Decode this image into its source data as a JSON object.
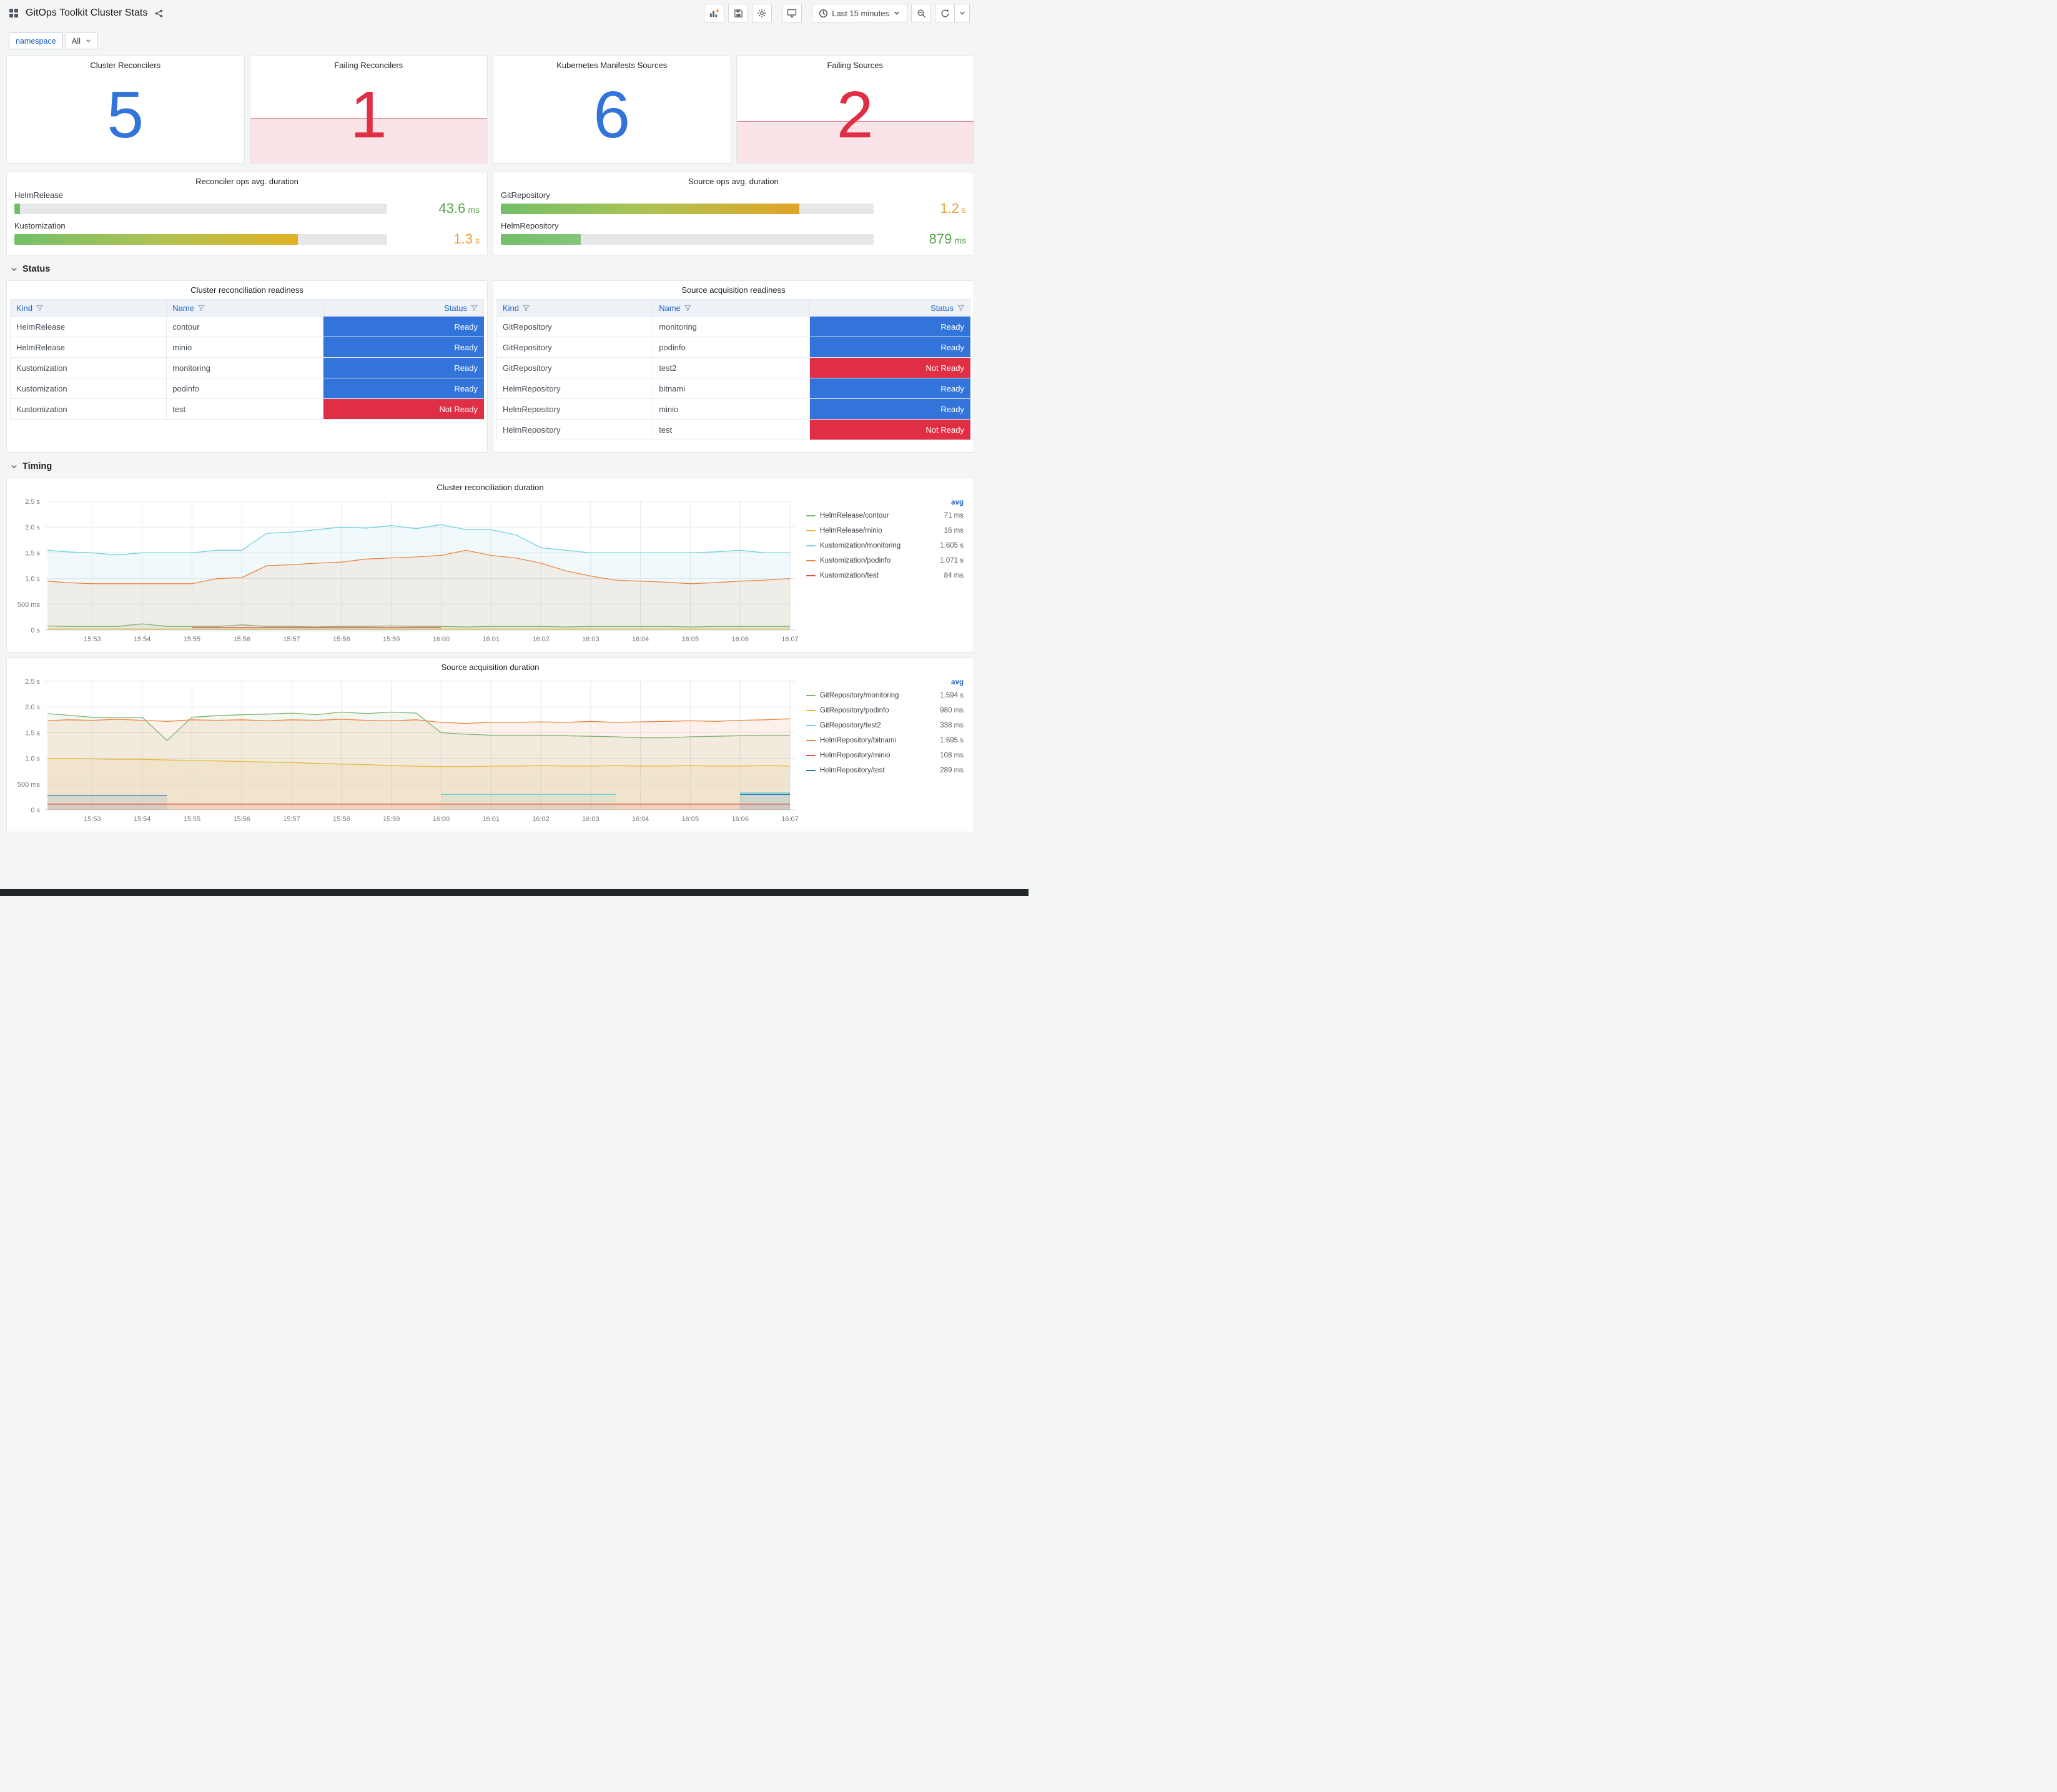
{
  "header": {
    "title": "GitOps Toolkit Cluster Stats",
    "time_range_label": "Last 15 minutes"
  },
  "variables": {
    "label": "namespace",
    "value": "All"
  },
  "sections": {
    "status": "Status",
    "timing": "Timing"
  },
  "colors": {
    "blue": "#3274D9",
    "red": "#E02F44",
    "green_text": "#56A64B",
    "orange_text": "#EDA032"
  },
  "stats": [
    {
      "title": "Cluster Reconcilers",
      "value": "5",
      "color": "#3274D9",
      "spark_pct": 0
    },
    {
      "title": "Failing Reconcilers",
      "value": "1",
      "color": "#E02F44",
      "spark_pct": 42
    },
    {
      "title": "Kubernetes Manifests Sources",
      "value": "6",
      "color": "#3274D9",
      "spark_pct": 0
    },
    {
      "title": "Failing Sources",
      "value": "2",
      "color": "#E02F44",
      "spark_pct": 39
    }
  ],
  "gauges": [
    {
      "title": "Reconciler ops avg. duration",
      "rows": [
        {
          "label": "HelmRelease",
          "value": "43.6",
          "unit": "ms",
          "pct": 1.5,
          "gradient": [
            "#73BF69",
            "#73BF69"
          ],
          "value_color": "#56A64B"
        },
        {
          "label": "Kustomization",
          "value": "1.3",
          "unit": "s",
          "pct": 76,
          "gradient": [
            "#73BF69",
            "#AEC253",
            "#E0B224"
          ],
          "value_color": "#EDA032"
        }
      ]
    },
    {
      "title": "Source ops avg. duration",
      "rows": [
        {
          "label": "GitRepository",
          "value": "1.2",
          "unit": "s",
          "pct": 80,
          "gradient": [
            "#73BF69",
            "#AEC253",
            "#E2A426"
          ],
          "value_color": "#EDA032"
        },
        {
          "label": "HelmRepository",
          "value": "879",
          "unit": "ms",
          "pct": 21.5,
          "gradient": [
            "#73BF69",
            "#85C47B"
          ],
          "value_color": "#56A64B"
        }
      ]
    }
  ],
  "tables": [
    {
      "title": "Cluster reconciliation readiness",
      "columns": [
        "Kind",
        "Name",
        "Status"
      ],
      "rows": [
        {
          "kind": "HelmRelease",
          "name": "contour",
          "status": "Ready"
        },
        {
          "kind": "HelmRelease",
          "name": "minio",
          "status": "Ready"
        },
        {
          "kind": "Kustomization",
          "name": "monitoring",
          "status": "Ready"
        },
        {
          "kind": "Kustomization",
          "name": "podinfo",
          "status": "Ready"
        },
        {
          "kind": "Kustomization",
          "name": "test",
          "status": "Not Ready"
        }
      ]
    },
    {
      "title": "Source acquisition readiness",
      "columns": [
        "Kind",
        "Name",
        "Status"
      ],
      "rows": [
        {
          "kind": "GitRepository",
          "name": "monitoring",
          "status": "Ready"
        },
        {
          "kind": "GitRepository",
          "name": "podinfo",
          "status": "Ready"
        },
        {
          "kind": "GitRepository",
          "name": "test2",
          "status": "Not Ready"
        },
        {
          "kind": "HelmRepository",
          "name": "bitnami",
          "status": "Ready"
        },
        {
          "kind": "HelmRepository",
          "name": "minio",
          "status": "Ready"
        },
        {
          "kind": "HelmRepository",
          "name": "test",
          "status": "Not Ready"
        }
      ]
    }
  ],
  "chart_data": [
    {
      "type": "line",
      "title": "Cluster reconciliation duration",
      "legend_header": "avg",
      "xlim": [
        -0.95,
        14.1
      ],
      "ylim": [
        0,
        2.5
      ],
      "x_ticks": [
        "15:53",
        "15:54",
        "15:55",
        "15:56",
        "15:57",
        "15:58",
        "15:59",
        "16:00",
        "16:01",
        "16:02",
        "16:03",
        "16:04",
        "16:05",
        "16:06",
        "16:07"
      ],
      "y_ticks": [
        {
          "v": 0,
          "label": "0 s"
        },
        {
          "v": 0.5,
          "label": "500 ms"
        },
        {
          "v": 1,
          "label": "1.0 s"
        },
        {
          "v": 1.5,
          "label": "1.5 s"
        },
        {
          "v": 2,
          "label": "2.0 s"
        },
        {
          "v": 2.5,
          "label": "2.5 s"
        }
      ],
      "x": [
        -0.9,
        -0.5,
        0,
        0.5,
        1,
        1.5,
        2,
        2.5,
        3,
        3.5,
        4,
        4.5,
        5,
        5.5,
        6,
        6.5,
        7,
        7.5,
        8,
        8.5,
        9,
        9.5,
        10,
        10.5,
        11,
        11.5,
        12,
        12.5,
        13,
        13.5,
        14
      ],
      "series": [
        {
          "name": "HelmRelease/contour",
          "avg": "71 ms",
          "color": "#7EB26D",
          "values": [
            0.08,
            0.07,
            0.07,
            0.07,
            0.12,
            0.07,
            0.07,
            0.07,
            0.1,
            0.07,
            0.07,
            0.06,
            0.07,
            0.07,
            0.08,
            0.07,
            0.07,
            0.06,
            0.07,
            0.07,
            0.07,
            0.06,
            0.07,
            0.07,
            0.07,
            0.07,
            0.06,
            0.07,
            0.07,
            0.07,
            0.07
          ]
        },
        {
          "name": "HelmRelease/minio",
          "avg": "16 ms",
          "color": "#EAB839",
          "values": [
            0.02,
            0.02,
            0.02,
            0.02,
            0.02,
            0.02,
            0.02,
            0.02,
            0.02,
            0.02,
            0.02,
            0.02,
            0.02,
            0.02,
            0.02,
            0.02,
            0.02,
            0.02,
            0.02,
            0.02,
            0.02,
            0.02,
            0.02,
            0.02,
            0.02,
            0.02,
            0.02,
            0.02,
            0.02,
            0.02,
            0.02
          ]
        },
        {
          "name": "Kustomization/monitoring",
          "avg": "1.605 s",
          "color": "#6ED0E0",
          "values": [
            1.55,
            1.52,
            1.5,
            1.46,
            1.5,
            1.5,
            1.5,
            1.55,
            1.55,
            1.88,
            1.9,
            1.95,
            2.0,
            1.98,
            2.03,
            1.97,
            2.05,
            1.95,
            1.95,
            1.85,
            1.6,
            1.55,
            1.5,
            1.5,
            1.5,
            1.5,
            1.5,
            1.52,
            1.55,
            1.5,
            1.5
          ]
        },
        {
          "name": "Kustomization/podinfo",
          "avg": "1.071 s",
          "color": "#EF843C",
          "values": [
            0.95,
            0.92,
            0.9,
            0.9,
            0.9,
            0.9,
            0.9,
            1.0,
            1.02,
            1.25,
            1.27,
            1.3,
            1.32,
            1.38,
            1.4,
            1.42,
            1.45,
            1.55,
            1.45,
            1.4,
            1.3,
            1.15,
            1.05,
            0.97,
            0.95,
            0.93,
            0.9,
            0.92,
            0.95,
            0.97,
            1.0
          ]
        },
        {
          "name": "Kustomization/test",
          "avg": "84 ms",
          "color": "#E24D42",
          "values": [
            null,
            null,
            null,
            null,
            null,
            null,
            0.05,
            0.05,
            0.05,
            0.05,
            0.05,
            0.05,
            0.05,
            0.05,
            0.05,
            0.05,
            0.05,
            null,
            null,
            null,
            null,
            null,
            null,
            null,
            null,
            null,
            null,
            null,
            null,
            null,
            null
          ]
        }
      ]
    },
    {
      "type": "line",
      "title": "Source acquisition duration",
      "legend_header": "avg",
      "xlim": [
        -0.95,
        14.1
      ],
      "ylim": [
        0,
        2.5
      ],
      "x_ticks": [
        "15:53",
        "15:54",
        "15:55",
        "15:56",
        "15:57",
        "15:58",
        "15:59",
        "16:00",
        "16:01",
        "16:02",
        "16:03",
        "16:04",
        "16:05",
        "16:06",
        "16:07"
      ],
      "y_ticks": [
        {
          "v": 0,
          "label": "0 s"
        },
        {
          "v": 0.5,
          "label": "500 ms"
        },
        {
          "v": 1,
          "label": "1.0 s"
        },
        {
          "v": 1.5,
          "label": "1.5 s"
        },
        {
          "v": 2,
          "label": "2.0 s"
        },
        {
          "v": 2.5,
          "label": "2.5 s"
        }
      ],
      "x": [
        -0.9,
        -0.5,
        0,
        0.5,
        1,
        1.5,
        2,
        2.5,
        3,
        3.5,
        4,
        4.5,
        5,
        5.5,
        6,
        6.5,
        7,
        7.5,
        8,
        8.5,
        9,
        9.5,
        10,
        10.5,
        11,
        11.5,
        12,
        12.5,
        13,
        13.5,
        14
      ],
      "series": [
        {
          "name": "GitRepository/monitoring",
          "avg": "1.594 s",
          "color": "#7EB26D",
          "values": [
            1.87,
            1.84,
            1.8,
            1.8,
            1.8,
            1.35,
            1.8,
            1.83,
            1.85,
            1.86,
            1.88,
            1.85,
            1.9,
            1.87,
            1.9,
            1.88,
            1.5,
            1.47,
            1.45,
            1.45,
            1.45,
            1.44,
            1.43,
            1.42,
            1.4,
            1.4,
            1.42,
            1.43,
            1.44,
            1.45,
            1.45
          ]
        },
        {
          "name": "GitRepository/podinfo",
          "avg": "980 ms",
          "color": "#EAB839",
          "values": [
            1.0,
            1.0,
            0.99,
            0.98,
            0.98,
            0.97,
            0.96,
            0.95,
            0.94,
            0.93,
            0.92,
            0.9,
            0.89,
            0.88,
            0.86,
            0.85,
            0.84,
            0.84,
            0.85,
            0.85,
            0.86,
            0.85,
            0.85,
            0.86,
            0.85,
            0.85,
            0.86,
            0.85,
            0.85,
            0.86,
            0.85
          ]
        },
        {
          "name": "GitRepository/test2",
          "avg": "338 ms",
          "color": "#6ED0E0",
          "values": [
            null,
            null,
            null,
            null,
            null,
            null,
            null,
            null,
            null,
            null,
            null,
            null,
            null,
            null,
            null,
            null,
            0.3,
            0.3,
            0.3,
            0.3,
            0.3,
            0.3,
            0.3,
            0.3,
            null,
            null,
            null,
            null,
            0.33,
            0.33,
            0.33
          ]
        },
        {
          "name": "HelmRepository/bitnami",
          "avg": "1.695 s",
          "color": "#EF843C",
          "values": [
            1.73,
            1.75,
            1.74,
            1.76,
            1.74,
            1.72,
            1.75,
            1.74,
            1.75,
            1.73,
            1.75,
            1.74,
            1.76,
            1.74,
            1.73,
            1.75,
            1.7,
            1.68,
            1.7,
            1.7,
            1.71,
            1.7,
            1.72,
            1.7,
            1.71,
            1.72,
            1.73,
            1.72,
            1.74,
            1.75,
            1.77
          ]
        },
        {
          "name": "HelmRepository/minio",
          "avg": "108 ms",
          "color": "#E24D42",
          "values": [
            0.11,
            0.11,
            0.11,
            0.11,
            0.11,
            0.11,
            0.11,
            0.11,
            0.11,
            0.11,
            0.11,
            0.11,
            0.11,
            0.11,
            0.11,
            0.11,
            0.11,
            0.11,
            0.11,
            0.11,
            0.11,
            0.11,
            0.11,
            0.11,
            0.11,
            0.11,
            0.11,
            0.11,
            0.11,
            0.11,
            0.11
          ]
        },
        {
          "name": "HelmRepository/test",
          "avg": "289 ms",
          "color": "#1F78C1",
          "values": [
            0.28,
            0.28,
            0.28,
            0.28,
            0.28,
            0.28,
            null,
            null,
            null,
            null,
            null,
            null,
            null,
            null,
            null,
            null,
            null,
            null,
            null,
            null,
            null,
            null,
            null,
            null,
            null,
            null,
            null,
            null,
            0.3,
            0.3,
            0.3
          ]
        }
      ]
    }
  ]
}
